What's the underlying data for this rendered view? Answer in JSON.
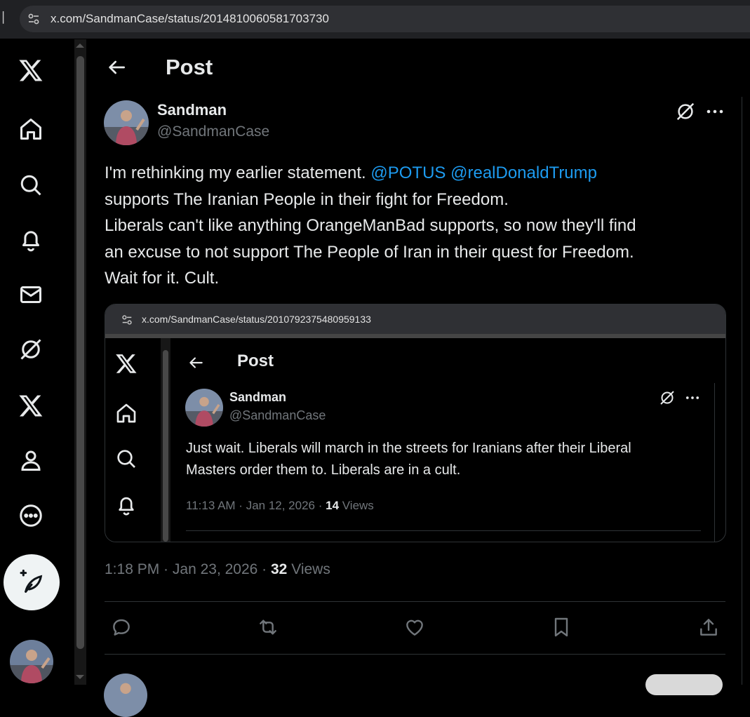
{
  "browser": {
    "url": "x.com/SandmanCase/status/2014810060581703730"
  },
  "sidebar": {
    "items": [
      {
        "icon": "x-logo-icon"
      },
      {
        "icon": "home-icon"
      },
      {
        "icon": "search-icon"
      },
      {
        "icon": "notifications-icon"
      },
      {
        "icon": "messages-icon"
      },
      {
        "icon": "grok-icon"
      },
      {
        "icon": "premium-x-icon"
      },
      {
        "icon": "profile-icon"
      },
      {
        "icon": "more-icon"
      }
    ],
    "compose_icon": "compose-feather-icon"
  },
  "header": {
    "title": "Post"
  },
  "post": {
    "display_name": "Sandman",
    "handle": "@SandmanCase",
    "text_lines": [
      "I'm rethinking my earlier statement. ",
      "supports The Iranian People in their fight for Freedom.",
      "Liberals can't like anything OrangeManBad supports, so now they'll find",
      "an excuse to not support The People of Iran in their quest for Freedom.",
      "Wait for it. Cult."
    ],
    "mentions": [
      "@POTUS",
      "@realDonaldTrump"
    ],
    "time": "1:18 PM",
    "date": "Jan 23, 2026",
    "sep": " · ",
    "views_count": "32",
    "views_label": " Views"
  },
  "embedded": {
    "url": "x.com/SandmanCase/status/2010792375480959133",
    "title": "Post",
    "display_name": "Sandman",
    "handle": "@SandmanCase",
    "text_lines": [
      "Just wait. Liberals will march in the streets for Iranians after their Liberal",
      "Masters order them to. Liberals are in a cult."
    ],
    "time": "11:13 AM",
    "date": "Jan 12, 2026",
    "sep": " · ",
    "views_count": "14",
    "views_label": " Views"
  },
  "actions": [
    "reply-icon",
    "repost-icon",
    "like-icon",
    "bookmark-icon",
    "share-icon"
  ],
  "colors": {
    "background": "#000000",
    "text": "#e7e9ea",
    "muted": "#71767b",
    "link": "#1d9bf0",
    "divider": "#2f3336"
  }
}
